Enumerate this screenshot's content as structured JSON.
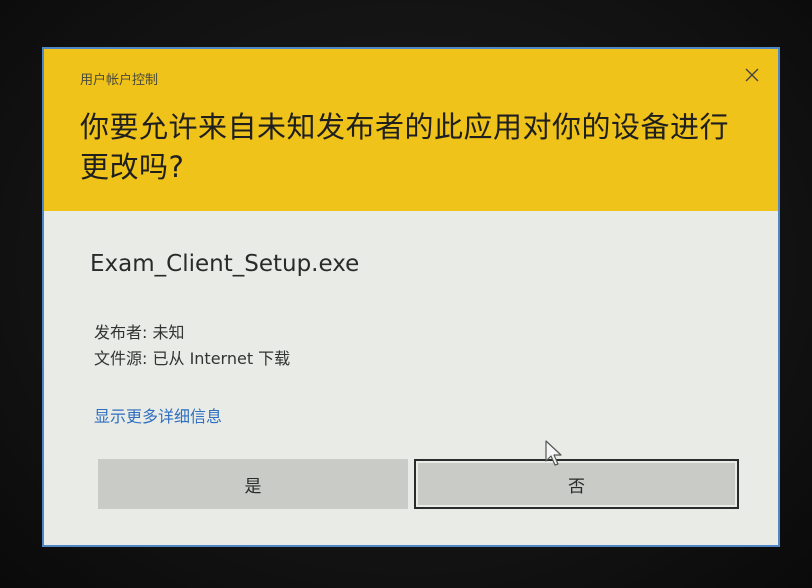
{
  "dialog": {
    "caption": "用户帐户控制",
    "question": "你要允许来自未知发布者的此应用对你的设备进行更改吗?",
    "filename": "Exam_Client_Setup.exe",
    "publisher_line": "发布者: 未知",
    "source_line": "文件源: 已从 Internet 下载",
    "more_details_link": "显示更多详细信息",
    "yes_label": "是",
    "no_label": "否"
  },
  "icons": {
    "close": "close-icon",
    "cursor": "mouse-pointer-icon"
  },
  "colors": {
    "header": "#f0c31a",
    "body": "#e9ebe6",
    "border": "#4f86c6",
    "link": "#2f6fc0",
    "button": "#c9cbc7"
  }
}
